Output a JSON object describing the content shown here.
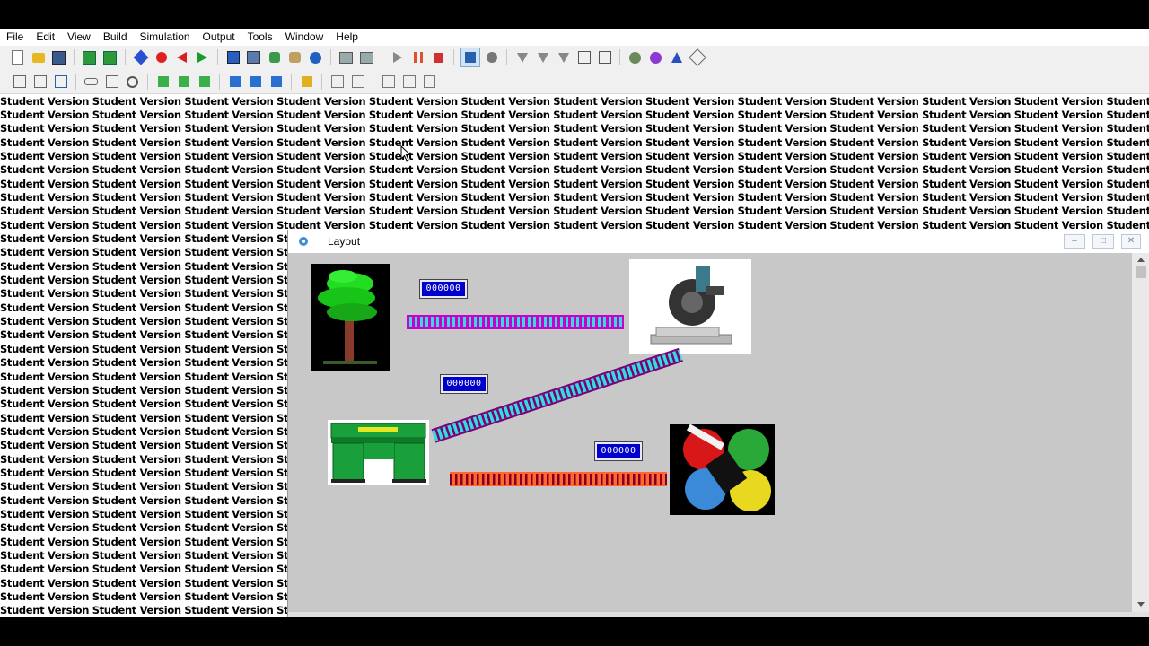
{
  "menubar": {
    "items": [
      {
        "label": "File"
      },
      {
        "label": "Edit"
      },
      {
        "label": "View"
      },
      {
        "label": "Build"
      },
      {
        "label": "Simulation"
      },
      {
        "label": "Output"
      },
      {
        "label": "Tools"
      },
      {
        "label": "Window"
      },
      {
        "label": "Help"
      }
    ]
  },
  "watermark": {
    "full_line": "Student Version Student Version Student Version Student Version Student Version Student Version Student Version Student Version Student Version Student Version Student Version Student Version Student Ve",
    "clipped_line": "Student Version Student Version Student Version St",
    "full_lines_count": 10,
    "clipped_lines_count": 28
  },
  "layout_window": {
    "title": "Layout",
    "minimize_label": "–",
    "maximize_label": "□",
    "close_label": "✕"
  },
  "counters": {
    "tree": "000000",
    "middle": "000000",
    "paint": "000000"
  },
  "colors": {
    "conveyor_magenta": "#cc00cc",
    "conveyor_cyan": "#33dddd",
    "conveyor_purple": "#7a007a",
    "conveyor_orange": "#ff6633",
    "conveyor_maroon": "#800020",
    "counter_blue": "#0000cc",
    "machine_green": "#1aa03a"
  }
}
